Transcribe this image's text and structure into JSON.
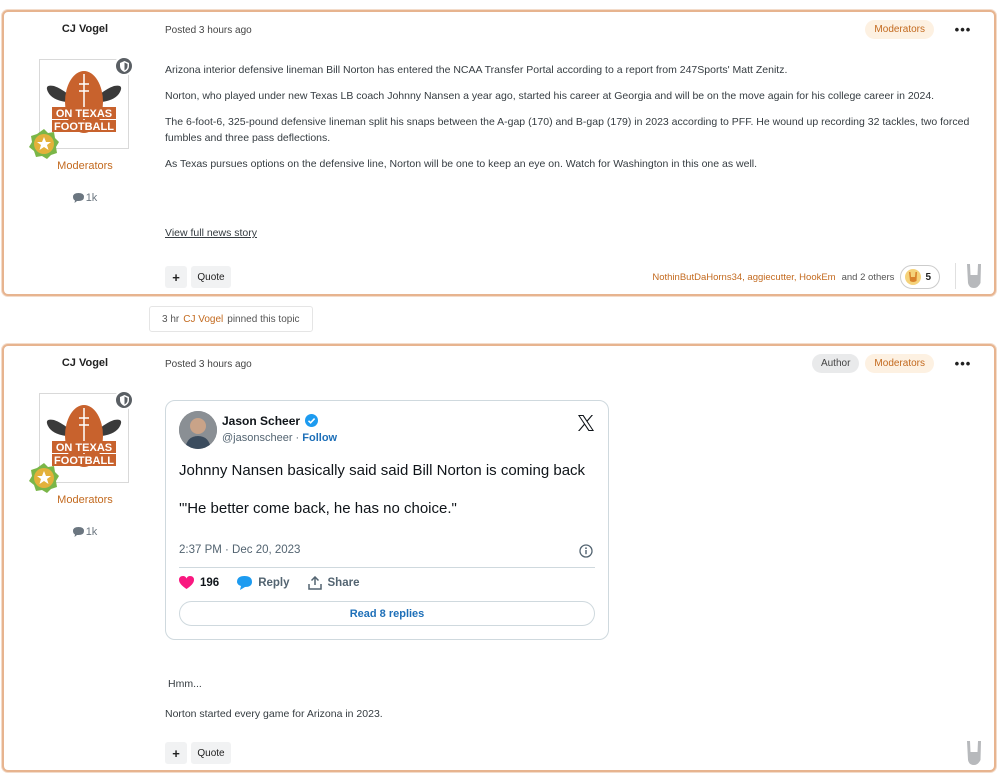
{
  "post1": {
    "author": "CJ Vogel",
    "posted": "Posted 3 hours ago",
    "badge_moderators": "Moderators",
    "group": "Moderators",
    "post_count": "1k",
    "paragraphs": [
      "Arizona interior defensive lineman Bill Norton has entered the NCAA Transfer Portal according to a report from 247Sports' Matt Zenitz.",
      "Norton, who played under new Texas LB coach Johnny Nansen a year ago, started his career at Georgia and will be on the move again for his college career in 2024.",
      "The 6-foot-6, 325-pound defensive lineman split his snaps between the A-gap (170) and B-gap (179) in 2023 according to PFF. He wound up recording 32 tackles, two forced fumbles and three pass deflections.",
      "As Texas pursues options on the defensive line, Norton will be one to keep an eye on. Watch for Washington in this one as well."
    ],
    "news_link": "View full news story",
    "plus_label": "+",
    "quote_label": "Quote",
    "reactions": {
      "names": "NothinButDaHorns34, aggiecutter, HookEm",
      "others": "and 2 others",
      "count": "5",
      "icon": "hook-em-horns-icon"
    }
  },
  "pin_event": {
    "time": "3 hr",
    "user": "CJ Vogel",
    "action": "pinned this topic"
  },
  "post2": {
    "author": "CJ Vogel",
    "posted": "Posted 3 hours ago",
    "badge_author": "Author",
    "badge_moderators": "Moderators",
    "group": "Moderators",
    "post_count": "1k",
    "tweet": {
      "name": "Jason Scheer",
      "handle": "@jasonscheer",
      "separator": "·",
      "follow": "Follow",
      "text_1": "Johnny Nansen basically said said Bill Norton is coming back",
      "text_2": "'\"He better come back, he has no choice.\"",
      "date": "2:37 PM · Dec 20, 2023",
      "likes": "196",
      "reply": "Reply",
      "share": "Share",
      "read_replies": "Read 8 replies"
    },
    "line_1": "Hmm...",
    "line_2": "Norton started every game for Arizona in 2023.",
    "plus_label": "+",
    "quote_label": "Quote"
  },
  "avatar_logo": {
    "line1": "ON TEXAS",
    "line2": "FOOTBALL"
  },
  "colors": {
    "accent": "#c36a1f",
    "border": "#e7b48f",
    "link": "#1d6fb8",
    "heart": "#f91880"
  }
}
